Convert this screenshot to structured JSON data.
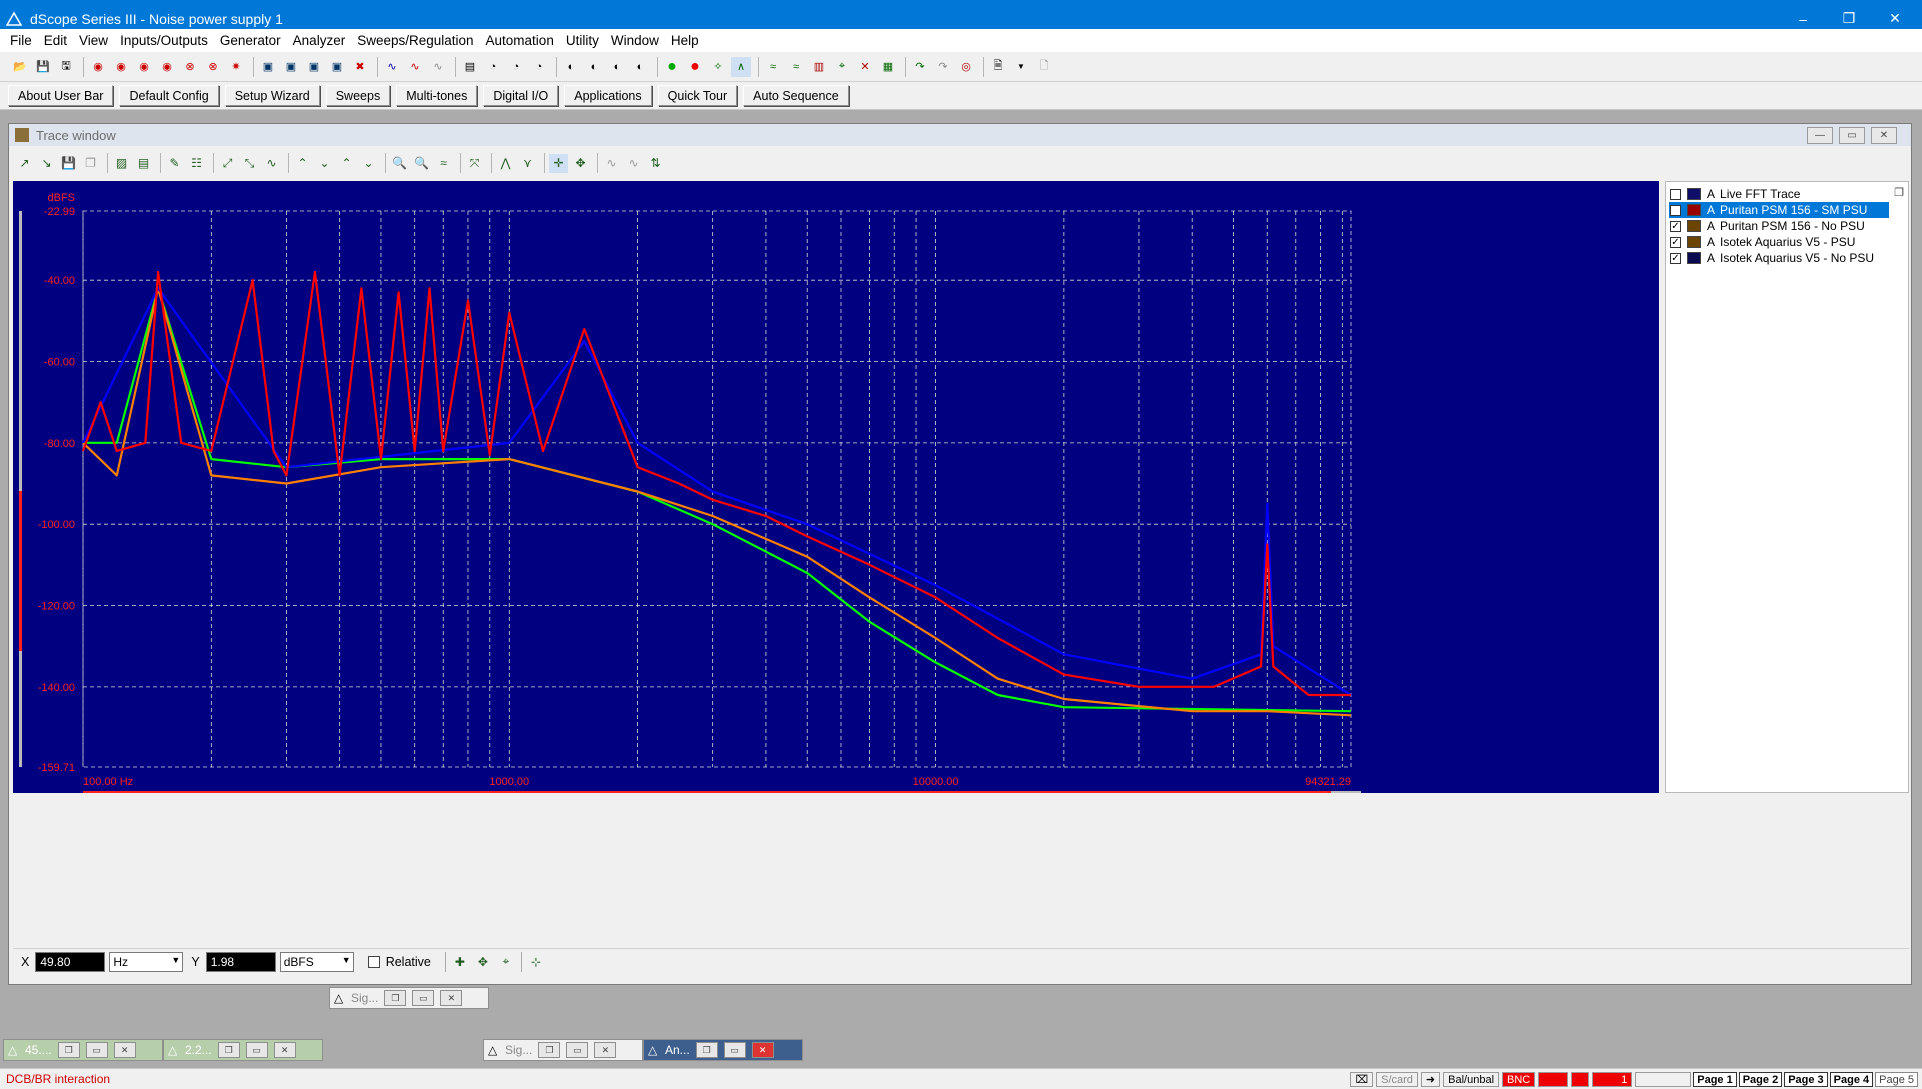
{
  "app": {
    "title": "dScope Series III - Noise power supply 1",
    "window_controls": [
      "–",
      "❐",
      "✕"
    ]
  },
  "menu": [
    "File",
    "Edit",
    "View",
    "Inputs/Outputs",
    "Generator",
    "Analyzer",
    "Sweeps/Regulation",
    "Automation",
    "Utility",
    "Window",
    "Help"
  ],
  "userbar": [
    "About User Bar",
    "Default Config",
    "Setup Wizard",
    "Sweeps",
    "Multi-tones",
    "Digital I/O",
    "Applications",
    "Quick Tour",
    "Auto Sequence"
  ],
  "trace_window": {
    "title": "Trace window",
    "legend": [
      {
        "checked": false,
        "channel": "A",
        "name": "Live FFT Trace",
        "selected": false
      },
      {
        "checked": true,
        "channel": "A",
        "name": "Puritan PSM 156 - SM PSU",
        "selected": true
      },
      {
        "checked": true,
        "channel": "A",
        "name": "Puritan PSM 156 - No PSU",
        "selected": false
      },
      {
        "checked": true,
        "channel": "A",
        "name": "Isotek Aquarius V5 - PSU",
        "selected": false
      },
      {
        "checked": true,
        "channel": "A",
        "name": "Isotek Aquarius V5 - No PSU",
        "selected": false
      }
    ],
    "readout": {
      "x_label": "X",
      "x_value": "49.80",
      "x_unit": "Hz",
      "y_label": "Y",
      "y_value": "1.98",
      "y_unit": "dBFS",
      "relative_label": "Relative"
    }
  },
  "chart_data": {
    "type": "line",
    "ylabel": "dBFS",
    "y_top_label": "-22.99",
    "y_bottom_label": "-159.71",
    "y_ticks": [
      "-40.00",
      "-60.00",
      "-80.00",
      "-100.00",
      "-120.00",
      "-140.00"
    ],
    "x_tick_labels": [
      "100.00 Hz",
      "1000.00",
      "10000.00",
      "94321.29"
    ],
    "x_scale": "log",
    "xlim": [
      100,
      94321.29
    ],
    "ylim": [
      -159.71,
      -22.99
    ],
    "grid": true,
    "background": "#000080",
    "series": [
      {
        "name": "Puritan PSM 156 - SM PSU",
        "color": "#ff0000",
        "points": [
          [
            100,
            -82
          ],
          [
            110,
            -70
          ],
          [
            120,
            -82
          ],
          [
            140,
            -80
          ],
          [
            150,
            -38
          ],
          [
            170,
            -80
          ],
          [
            200,
            -82
          ],
          [
            250,
            -40
          ],
          [
            280,
            -82
          ],
          [
            300,
            -88
          ],
          [
            350,
            -38
          ],
          [
            400,
            -88
          ],
          [
            450,
            -42
          ],
          [
            500,
            -84
          ],
          [
            550,
            -43
          ],
          [
            600,
            -82
          ],
          [
            650,
            -42
          ],
          [
            700,
            -82
          ],
          [
            800,
            -45
          ],
          [
            900,
            -83
          ],
          [
            1000,
            -48
          ],
          [
            1200,
            -82
          ],
          [
            1500,
            -52
          ],
          [
            2000,
            -86
          ],
          [
            2500,
            -90
          ],
          [
            3000,
            -94
          ],
          [
            4000,
            -98
          ],
          [
            5000,
            -103
          ],
          [
            7000,
            -110
          ],
          [
            10000,
            -118
          ],
          [
            14000,
            -128
          ],
          [
            20000,
            -137
          ],
          [
            30000,
            -140
          ],
          [
            45000,
            -140
          ],
          [
            58000,
            -135
          ],
          [
            60000,
            -105
          ],
          [
            62000,
            -135
          ],
          [
            75000,
            -142
          ],
          [
            94321,
            -142
          ]
        ]
      },
      {
        "name": "Puritan PSM 156 - No PSU",
        "color": "#ff8000",
        "points": [
          [
            100,
            -80
          ],
          [
            120,
            -88
          ],
          [
            150,
            -42
          ],
          [
            200,
            -88
          ],
          [
            300,
            -90
          ],
          [
            500,
            -86
          ],
          [
            1000,
            -84
          ],
          [
            2000,
            -92
          ],
          [
            3000,
            -98
          ],
          [
            5000,
            -108
          ],
          [
            7000,
            -118
          ],
          [
            10000,
            -128
          ],
          [
            14000,
            -138
          ],
          [
            20000,
            -143
          ],
          [
            40000,
            -146
          ],
          [
            60000,
            -146
          ],
          [
            94321,
            -147
          ]
        ]
      },
      {
        "name": "Isotek Aquarius V5 - PSU",
        "color": "#00ff00",
        "points": [
          [
            100,
            -80
          ],
          [
            120,
            -80
          ],
          [
            150,
            -42
          ],
          [
            200,
            -84
          ],
          [
            300,
            -86
          ],
          [
            500,
            -84
          ],
          [
            1000,
            -84
          ],
          [
            2000,
            -92
          ],
          [
            3000,
            -100
          ],
          [
            5000,
            -112
          ],
          [
            7000,
            -124
          ],
          [
            10000,
            -134
          ],
          [
            14000,
            -142
          ],
          [
            20000,
            -145
          ],
          [
            94321,
            -146
          ]
        ]
      },
      {
        "name": "Isotek Aquarius V5 - No PSU",
        "color": "#0000ff",
        "points": [
          [
            100,
            -80
          ],
          [
            150,
            -42
          ],
          [
            300,
            -86
          ],
          [
            1000,
            -80
          ],
          [
            1500,
            -55
          ],
          [
            2000,
            -80
          ],
          [
            3000,
            -92
          ],
          [
            5000,
            -100
          ],
          [
            10000,
            -115
          ],
          [
            20000,
            -132
          ],
          [
            40000,
            -138
          ],
          [
            58000,
            -132
          ],
          [
            60000,
            -95
          ],
          [
            62000,
            -130
          ],
          [
            94321,
            -142
          ]
        ]
      }
    ]
  },
  "minimized_windows": [
    {
      "label": "Sig..."
    },
    {
      "label": "45...."
    },
    {
      "label": "2.2..."
    },
    {
      "label": "Sig..."
    },
    {
      "label": "An..."
    }
  ],
  "status": {
    "text": "DCB/BR interaction",
    "cells": [
      "S/card",
      "Bal/unbal",
      "BNC",
      "",
      "1"
    ],
    "pages": [
      "Page 1",
      "Page 2",
      "Page 3",
      "Page 4",
      "Page 5"
    ]
  }
}
